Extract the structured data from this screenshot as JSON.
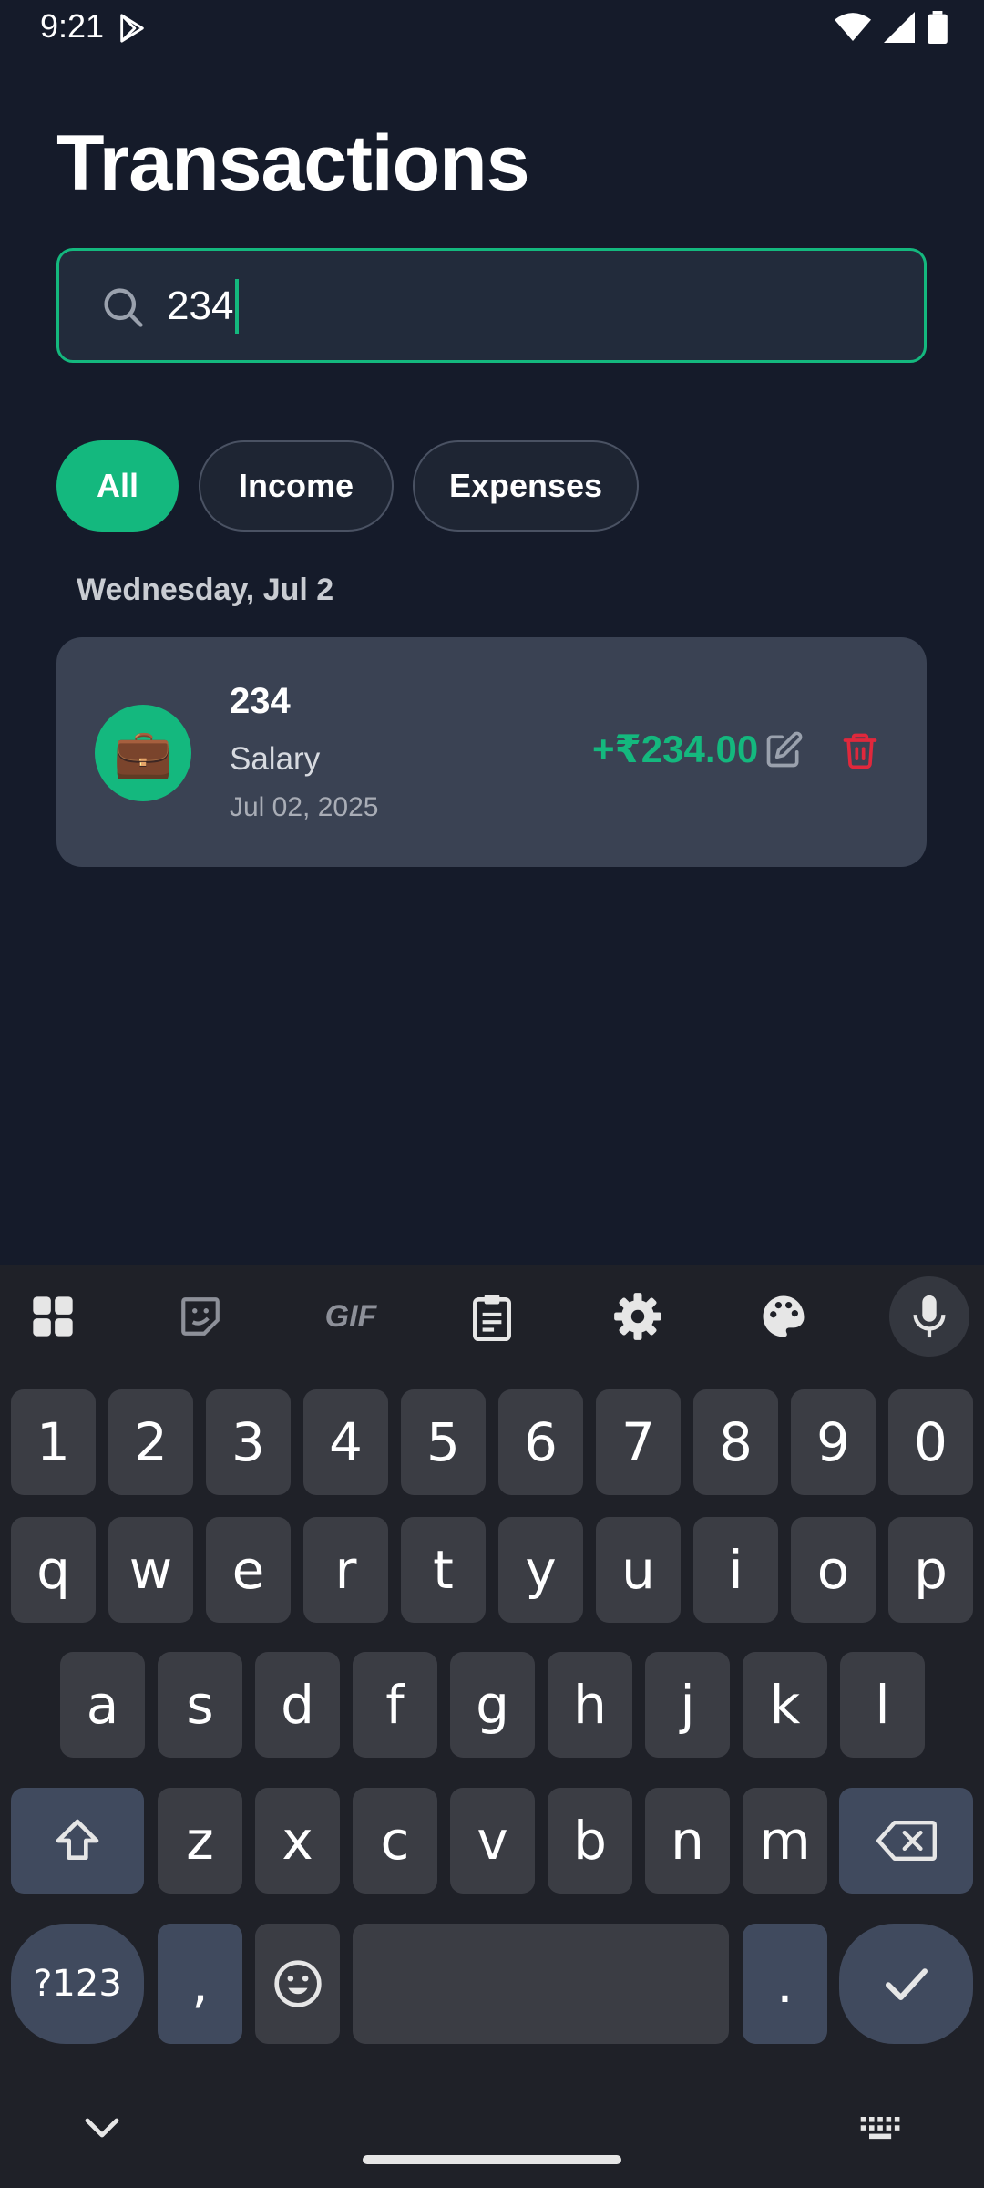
{
  "status_bar": {
    "time": "9:21"
  },
  "page": {
    "title": "Transactions"
  },
  "search": {
    "value": "234"
  },
  "filters": {
    "all": "All",
    "income": "Income",
    "expenses": "Expenses"
  },
  "date_header": "Wednesday, Jul 2",
  "transaction": {
    "title": "234",
    "category": "Salary",
    "date": "Jul 02, 2025",
    "amount": "+₹234.00",
    "icon": "💼"
  },
  "keyboard": {
    "number_row": [
      "1",
      "2",
      "3",
      "4",
      "5",
      "6",
      "7",
      "8",
      "9",
      "0"
    ],
    "row1": [
      "q",
      "w",
      "e",
      "r",
      "t",
      "y",
      "u",
      "i",
      "o",
      "p"
    ],
    "row2": [
      "a",
      "s",
      "d",
      "f",
      "g",
      "h",
      "j",
      "k",
      "l"
    ],
    "row3": [
      "z",
      "x",
      "c",
      "v",
      "b",
      "n",
      "m"
    ],
    "symbols_label": "?123",
    "comma": ",",
    "period": ".",
    "gif_label": "GIF"
  },
  "colors": {
    "accent": "#14b87e",
    "background": "#151b2a",
    "card": "#3a4253",
    "delete": "#e0283c"
  }
}
